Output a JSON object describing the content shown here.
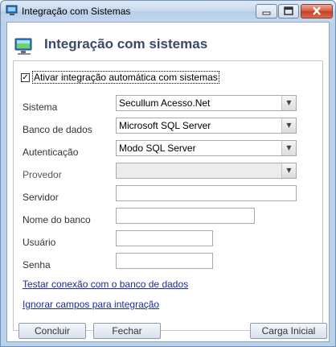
{
  "window": {
    "title": "Integração com Sistemas",
    "accent_color": "#b9d1ea",
    "controls": {
      "minimize": "minimize-icon",
      "maximize": "maximize-icon",
      "close": "close-icon"
    }
  },
  "header": {
    "title": "Integração com sistemas",
    "icon": "computer-monitor-icon"
  },
  "form": {
    "auto_integration": {
      "label": "Ativar integração automática com sistemas",
      "checked": true,
      "mark": "✓"
    },
    "sistema": {
      "label": "Sistema",
      "value": "Secullum Acesso.Net"
    },
    "banco_de_dados": {
      "label": "Banco de dados",
      "value": "Microsoft SQL Server"
    },
    "autenticacao": {
      "label": "Autenticação",
      "value": "Modo SQL Server"
    },
    "provedor": {
      "label": "Provedor",
      "value": ""
    },
    "servidor": {
      "label": "Servidor",
      "value": ""
    },
    "nome_do_banco": {
      "label": "Nome do banco",
      "value": ""
    },
    "usuario": {
      "label": "Usuário",
      "value": ""
    },
    "senha": {
      "label": "Senha",
      "value": ""
    },
    "dropdown_arrow": "▼"
  },
  "links": {
    "test_connection": "Testar conexão com o banco de dados",
    "ignore_fields": "Ignorar campos para integração"
  },
  "buttons": {
    "concluir": "Concluir",
    "fechar": "Fechar",
    "carga_inicial": "Carga Inicial"
  }
}
